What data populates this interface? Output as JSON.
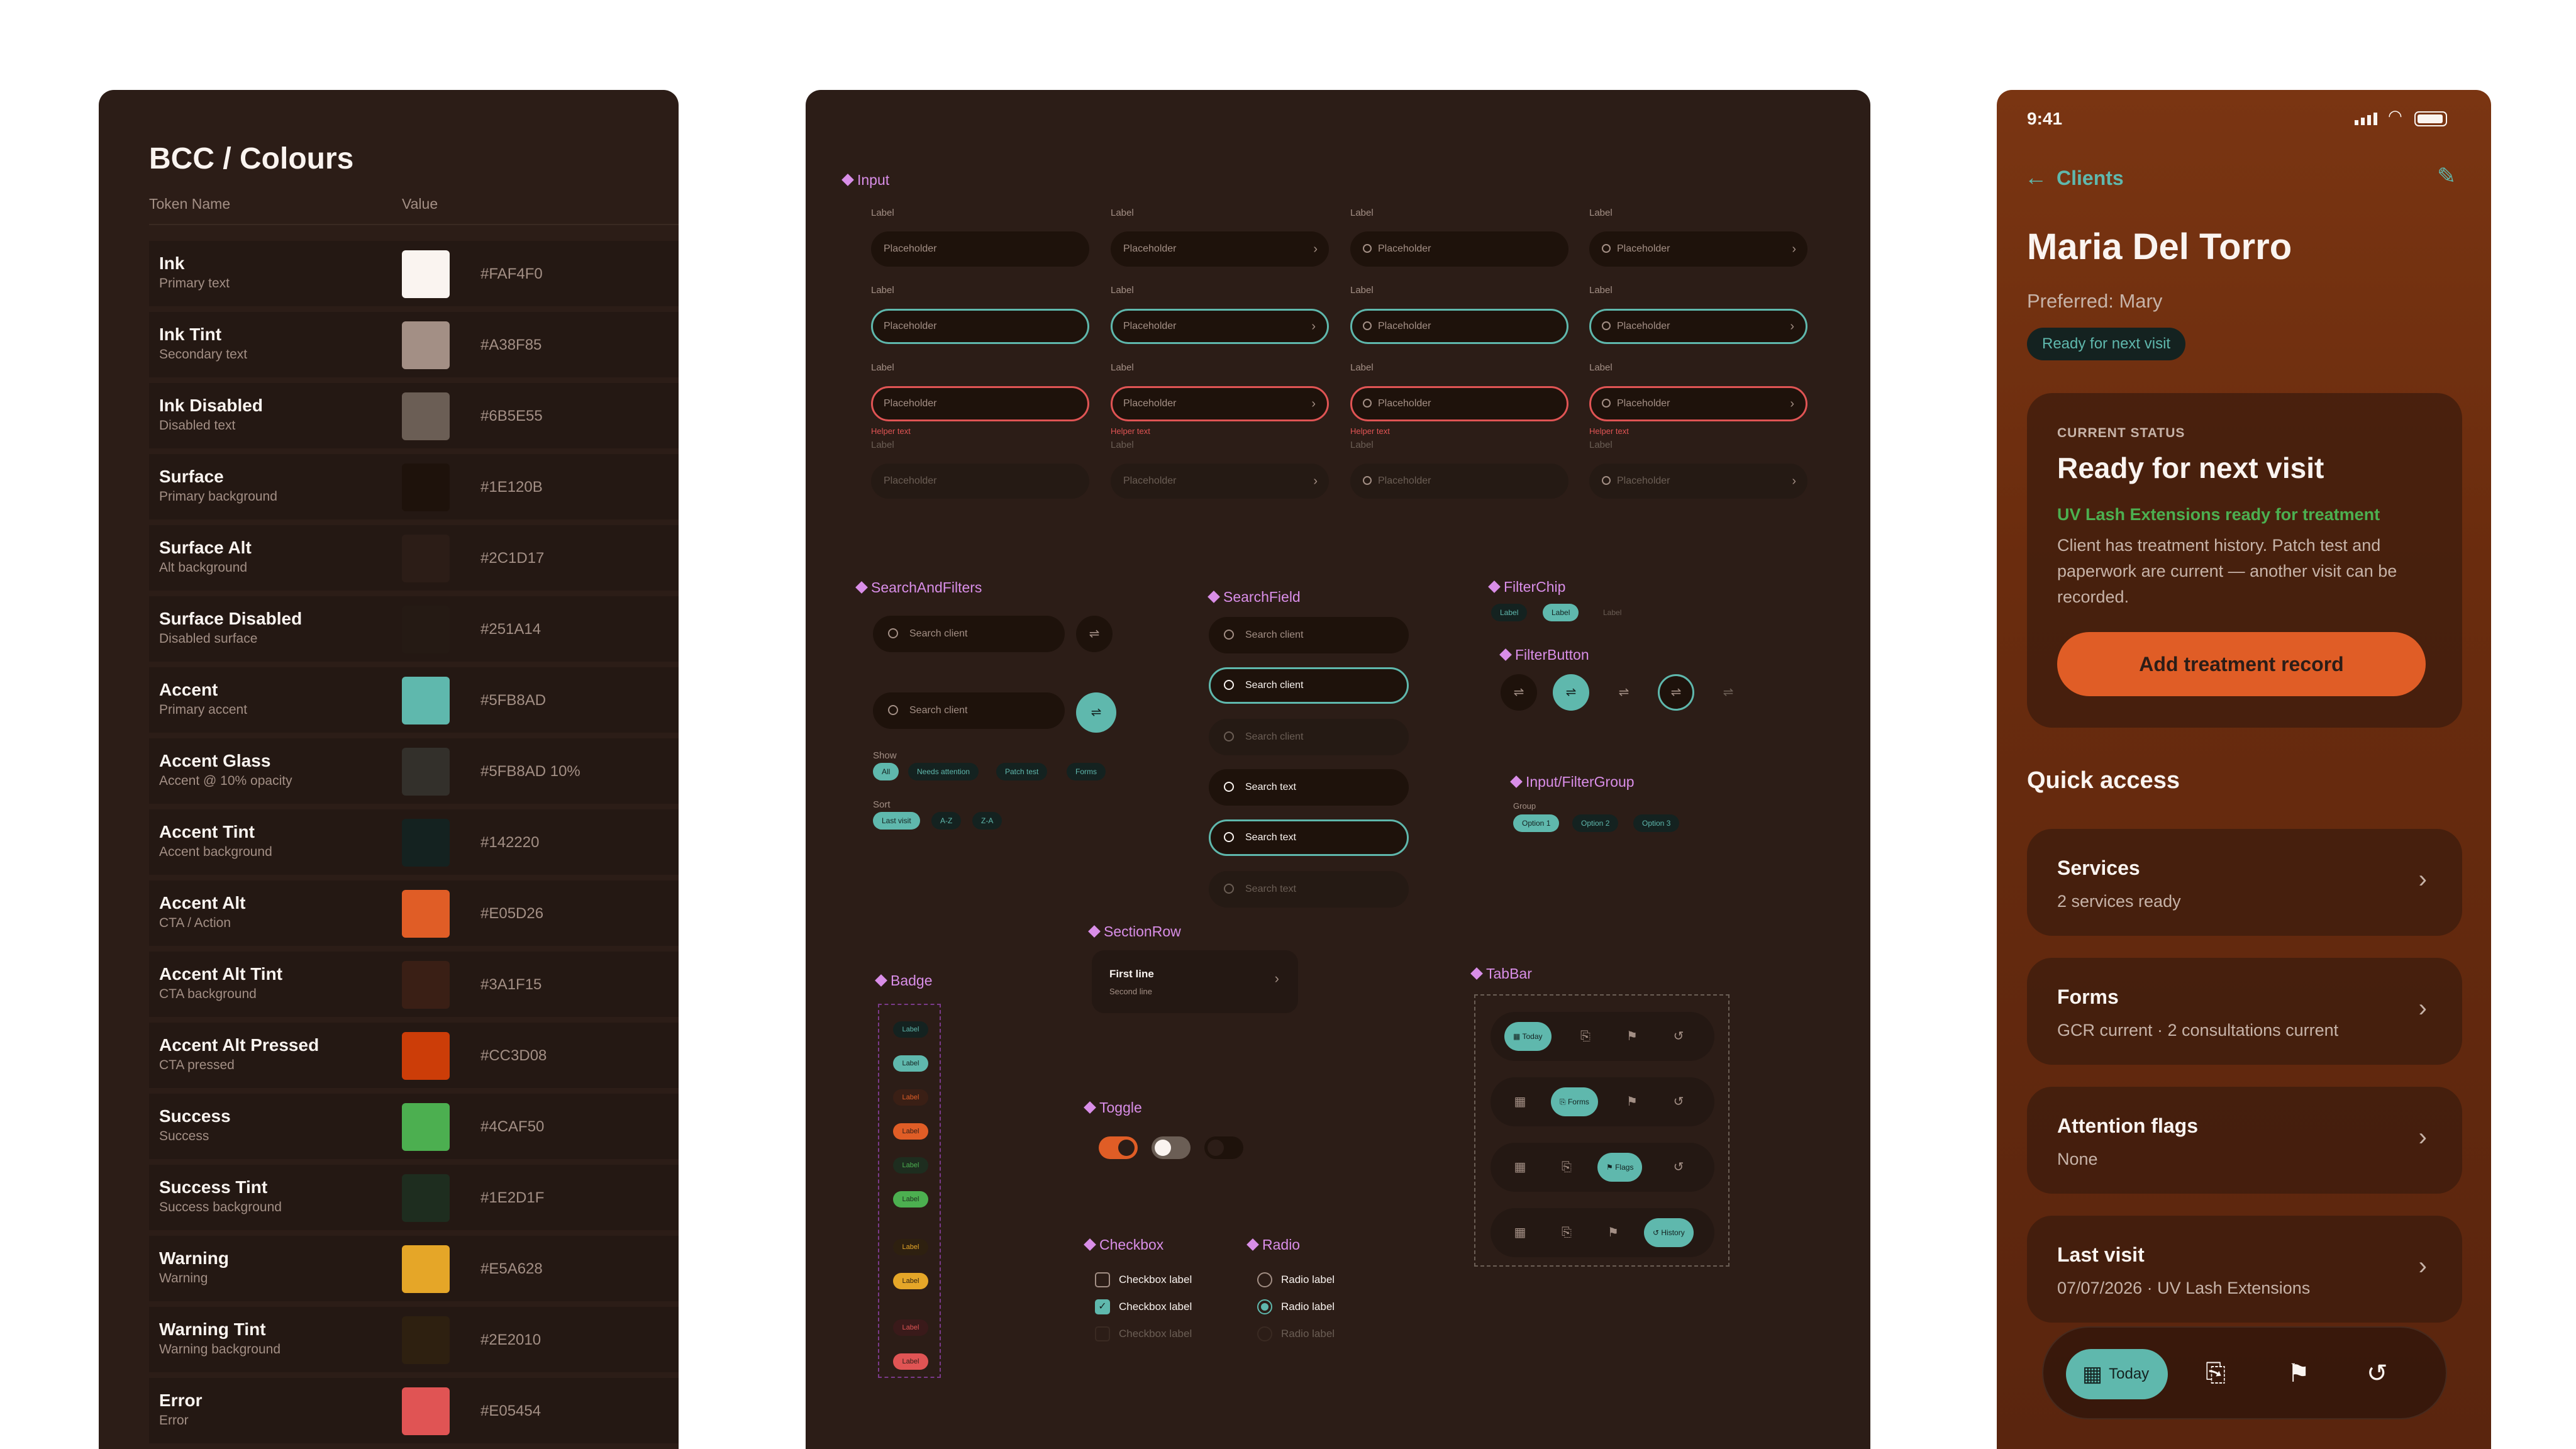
{
  "panel_tokens": {
    "title": "BCC / Colours",
    "col_name": "Token Name",
    "col_value": "Value",
    "tokens": [
      {
        "name": "Ink",
        "desc": "Primary text",
        "value": "#FAF4F0",
        "color": "#FAF4F0"
      },
      {
        "name": "Ink Tint",
        "desc": "Secondary text",
        "value": "#A38F85",
        "color": "#A38F85"
      },
      {
        "name": "Ink Disabled",
        "desc": "Disabled text",
        "value": "#6B5E55",
        "color": "#6B5E55"
      },
      {
        "name": "Surface",
        "desc": "Primary background",
        "value": "#1E120B",
        "color": "#1E120B"
      },
      {
        "name": "Surface Alt",
        "desc": "Alt background",
        "value": "#2C1D17",
        "color": "#2C1D17"
      },
      {
        "name": "Surface Disabled",
        "desc": "Disabled surface",
        "value": "#251A14",
        "color": "#251A14"
      },
      {
        "name": "Accent",
        "desc": "Primary accent",
        "value": "#5FB8AD",
        "color": "#5FB8AD"
      },
      {
        "name": "Accent Glass",
        "desc": "Accent @ 10% opacity",
        "value": "#5FB8AD 10%",
        "color": "#33302B"
      },
      {
        "name": "Accent Tint",
        "desc": "Accent background",
        "value": "#142220",
        "color": "#142220"
      },
      {
        "name": "Accent Alt",
        "desc": "CTA / Action",
        "value": "#E05D26",
        "color": "#E05D26"
      },
      {
        "name": "Accent Alt Tint",
        "desc": "CTA background",
        "value": "#3A1F15",
        "color": "#3A1F15"
      },
      {
        "name": "Accent Alt Pressed",
        "desc": "CTA pressed",
        "value": "#CC3D08",
        "color": "#CC3D08"
      },
      {
        "name": "Success",
        "desc": "Success",
        "value": "#4CAF50",
        "color": "#4CAF50"
      },
      {
        "name": "Success Tint",
        "desc": "Success background",
        "value": "#1E2D1F",
        "color": "#1E2D1F"
      },
      {
        "name": "Warning",
        "desc": "Warning",
        "value": "#E5A628",
        "color": "#E5A628"
      },
      {
        "name": "Warning Tint",
        "desc": "Warning background",
        "value": "#2E2010",
        "color": "#2E2010"
      },
      {
        "name": "Error",
        "desc": "Error",
        "value": "#E05454",
        "color": "#E05454"
      }
    ]
  },
  "panel_components": {
    "input": {
      "section": "Input",
      "label": "Label",
      "placeholder": "Placeholder",
      "helper": "Helper text"
    },
    "search_and_filters": {
      "section": "SearchAndFilters",
      "search_placeholder": "Search client",
      "show_label": "Show",
      "show_chips": [
        "All",
        "Needs attention",
        "Patch test",
        "Forms"
      ],
      "sort_label": "Sort",
      "sort_chips": [
        "Last visit",
        "A-Z",
        "Z-A"
      ]
    },
    "search_field": {
      "section": "SearchField",
      "client_placeholder": "Search client",
      "text_placeholder": "Search text"
    },
    "filter_chip": {
      "section": "FilterChip",
      "label": "Label"
    },
    "filter_button": {
      "section": "FilterButton"
    },
    "filter_group": {
      "section": "Input/FilterGroup",
      "group_label": "Group",
      "options": [
        "Option 1",
        "Option 2",
        "Option 3"
      ]
    },
    "section_row": {
      "section": "SectionRow",
      "first": "First line",
      "second": "Second line"
    },
    "badge": {
      "section": "Badge",
      "label": "Label",
      "pairs": [
        {
          "tint": "#142220",
          "tint_text": "#5FB8AD",
          "solid": "#5FB8AD",
          "solid_text": "#142220"
        },
        {
          "tint": "#3A1F15",
          "tint_text": "#E05D26",
          "solid": "#E05D26",
          "solid_text": "#2C1D17"
        },
        {
          "tint": "#1E2D1F",
          "tint_text": "#4CAF50",
          "solid": "#4CAF50",
          "solid_text": "#1E2D1F"
        },
        {
          "tint": "#2E2010",
          "tint_text": "#E5A628",
          "solid": "#E5A628",
          "solid_text": "#2E2010"
        },
        {
          "tint": "#3A1A1A",
          "tint_text": "#E05454",
          "solid": "#E05454",
          "solid_text": "#2C1D17"
        }
      ]
    },
    "tab_bar": {
      "section": "TabBar",
      "tabs": [
        "Today",
        "Forms",
        "Flags",
        "History"
      ]
    },
    "toggle": {
      "section": "Toggle"
    },
    "checkbox": {
      "section": "Checkbox",
      "label": "Checkbox label"
    },
    "radio": {
      "section": "Radio",
      "label": "Radio label"
    }
  },
  "panel_mobile": {
    "status_time": "9:41",
    "back_label": "Clients",
    "client_name": "Maria Del Torro",
    "preferred": "Preferred: Mary",
    "status_badge": "Ready for next visit",
    "status_card": {
      "eyebrow": "CURRENT STATUS",
      "heading": "Ready for next visit",
      "highlight": "UV Lash Extensions ready for treatment",
      "body": "Client has treatment history. Patch test and paperwork are current — another visit can be recorded.",
      "cta": "Add treatment record"
    },
    "quick_access_title": "Quick access",
    "quick_access": [
      {
        "title": "Services",
        "subtitle": "2 services ready"
      },
      {
        "title": "Forms",
        "subtitle": "GCR current · 2 consultations current"
      },
      {
        "title": "Attention flags",
        "subtitle": "None"
      },
      {
        "title": "Last visit",
        "subtitle": "07/07/2026 · UV Lash Extensions"
      }
    ],
    "tab_active": "Today"
  }
}
